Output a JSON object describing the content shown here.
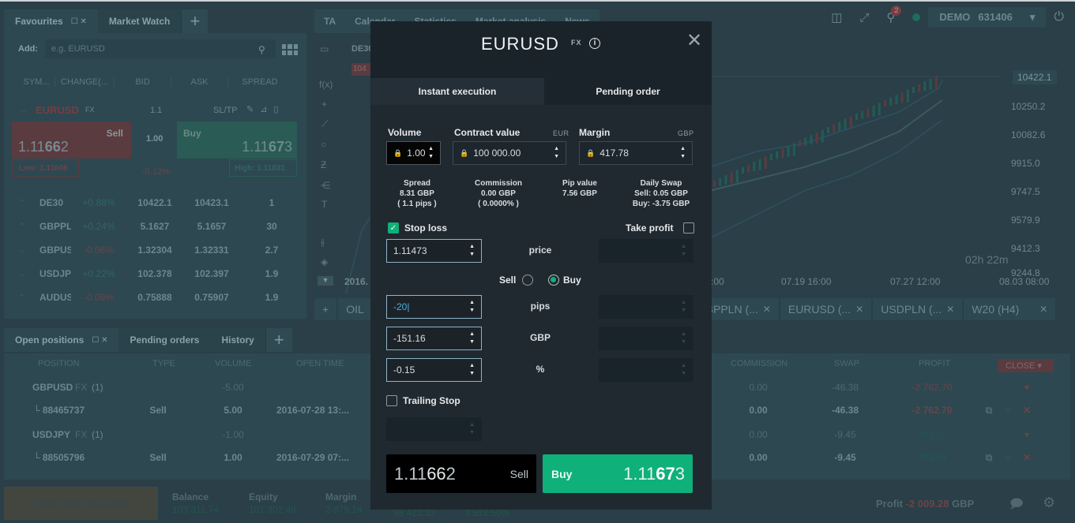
{
  "header": {
    "account_mode": "DEMO",
    "account_number": "631406",
    "notification_count": "2"
  },
  "favourites": {
    "tabs": [
      {
        "label": "Favourites"
      },
      {
        "label": "Market Watch"
      }
    ],
    "add_label": "Add:",
    "search_placeholder": "e.g. EURUSD",
    "columns": [
      "SYM...",
      "CHANGE(...",
      "BID",
      "ASK",
      "SPREAD"
    ],
    "selected": {
      "symbol": "EURUSD",
      "tag": "FX",
      "spread": "1.1",
      "sltp_label": "SL/TP",
      "sell_label": "Sell",
      "sell_price_pre": "1.11",
      "sell_price_big": "66",
      "sell_price_post": "2",
      "buy_label": "Buy",
      "buy_price_pre": "1.11",
      "buy_price_big": "67",
      "buy_price_post": "3",
      "volume": "1.00",
      "low": "Low: 1.11606",
      "high": "High: 1.11831",
      "change": "-0.12%"
    },
    "rows": [
      {
        "dir": "up",
        "symbol": "DE30",
        "change": "+0.88%",
        "bid": "10422.1",
        "ask": "10423.1",
        "spread": "1"
      },
      {
        "dir": "up",
        "symbol": "GBPPL",
        "change": "+0.24%",
        "bid": "5.1627",
        "ask": "5.1657",
        "spread": "30"
      },
      {
        "dir": "down",
        "symbol": "GBPUS",
        "change": "-0.06%",
        "bid": "1.32304",
        "ask": "1.32331",
        "spread": "2.7"
      },
      {
        "dir": "down",
        "symbol": "USDJP",
        "change": "+0.22%",
        "bid": "102.378",
        "ask": "102.397",
        "spread": "1.9"
      },
      {
        "dir": "up",
        "symbol": "AUDUS",
        "change": "-0.09%",
        "bid": "0.75888",
        "ask": "0.75907",
        "spread": "1.9"
      }
    ]
  },
  "chart": {
    "top_tabs": [
      "TA",
      "Calendar",
      "Statistics",
      "Market analysis",
      "News"
    ],
    "instrument": "DE30",
    "badge": "104",
    "current_price": "10422.1",
    "y_ticks": [
      "10422.1",
      "10250.2",
      "10082.6",
      "9915.0",
      "9747.5",
      "9579.9",
      "9412.3",
      "9244.8"
    ],
    "x_ticks": [
      "2016.",
      ":00",
      "07.19 16:00",
      "07.27 12:00",
      "08.03 08:00"
    ],
    "timer_h": "02h",
    "timer_m": "22m",
    "symbol_tabs": [
      "OIL",
      "GBPPLN (...",
      "EURUSD (...",
      "USDPLN (...",
      "W20 (H4)"
    ]
  },
  "positions": {
    "tabs": [
      {
        "label": "Open positions"
      },
      {
        "label": "Pending orders"
      },
      {
        "label": "History"
      }
    ],
    "columns": [
      "POSITION",
      "TYPE",
      "VOLUME",
      "OPEN TIME",
      "COMMISSION",
      "SWAP",
      "PROFIT"
    ],
    "close_label": "CLOSE",
    "rows": [
      {
        "kind": "group",
        "position": "GBPUSD",
        "tag": "FX",
        "count": "(1)",
        "type": "",
        "volume": "-5.00",
        "open_time": "",
        "commission": "0.00",
        "swap": "-46.38",
        "profit": "-2 762.70",
        "profit_dir": "down"
      },
      {
        "kind": "item",
        "position": "88465737",
        "tag": "",
        "count": "",
        "type": "Sell",
        "volume": "5.00",
        "open_time": "2016-07-28 13:...",
        "commission": "0.00",
        "swap": "-46.38",
        "profit": "-2 762.70",
        "profit_dir": "down"
      },
      {
        "kind": "group",
        "position": "USDJPY",
        "tag": "FX",
        "count": "(1)",
        "type": "",
        "volume": "-1.00",
        "open_time": "",
        "commission": "0.00",
        "swap": "-9.45",
        "profit": "793.36",
        "profit_dir": "up"
      },
      {
        "kind": "item",
        "position": "88505796",
        "tag": "",
        "count": "",
        "type": "Sell",
        "volume": "1.00",
        "open_time": "2016-07-29 07:...",
        "commission": "0.00",
        "swap": "-9.45",
        "profit": "793.36",
        "profit_dir": "up"
      }
    ]
  },
  "status": {
    "open_real": "Open real account",
    "balance_label": "Balance",
    "balance": "103 311.74",
    "equity_label": "Equity",
    "equity": "101 302.46",
    "margin_label": "Margin",
    "margin": "2 879.14",
    "free_margin": "98 423.32",
    "margin_level": "3 518.50%",
    "profit_label": "Profit",
    "profit": "-2 009.28",
    "profit_currency": "GBP"
  },
  "modal": {
    "symbol": "EURUSD",
    "tag": "FX",
    "tabs": {
      "instant": "Instant execution",
      "pending": "Pending order"
    },
    "volume_label": "Volume",
    "volume": "1.00",
    "contract_label": "Contract value",
    "contract_unit": "EUR",
    "contract": "100 000.00",
    "margin_label": "Margin",
    "margin_unit": "GBP",
    "margin": "417.78",
    "spread_label": "Spread",
    "spread_value": "8.31 GBP",
    "spread_pips": "( 1.1 pips )",
    "commission_label": "Commission",
    "commission_value": "0.00 GBP",
    "commission_pct": "( 0.0000% )",
    "pip_label": "Pip value",
    "pip_value": "7.56 GBP",
    "swap_label": "Daily Swap",
    "swap_sell": "Sell: 0.05 GBP",
    "swap_buy": "Buy: -3.75 GBP",
    "stop_loss_label": "Stop loss",
    "stop_loss_checked": true,
    "take_profit_label": "Take profit",
    "take_profit_checked": false,
    "sl_price": "1.11473",
    "price_label": "price",
    "side_sell": "Sell",
    "side_buy": "Buy",
    "side_selected": "Buy",
    "sl_pips": "-20",
    "pips_label": "pips",
    "sl_gbp": "-151.16",
    "gbp_label": "GBP",
    "sl_pct": "-0.15",
    "pct_label": "%",
    "trailing_label": "Trailing Stop",
    "trailing_checked": false,
    "sell_pre": "1.11",
    "sell_big": "66",
    "sell_post": "2",
    "sell_label": "Sell",
    "buy_label": "Buy",
    "buy_pre": "1.11",
    "buy_big": "67",
    "buy_post": "3"
  }
}
